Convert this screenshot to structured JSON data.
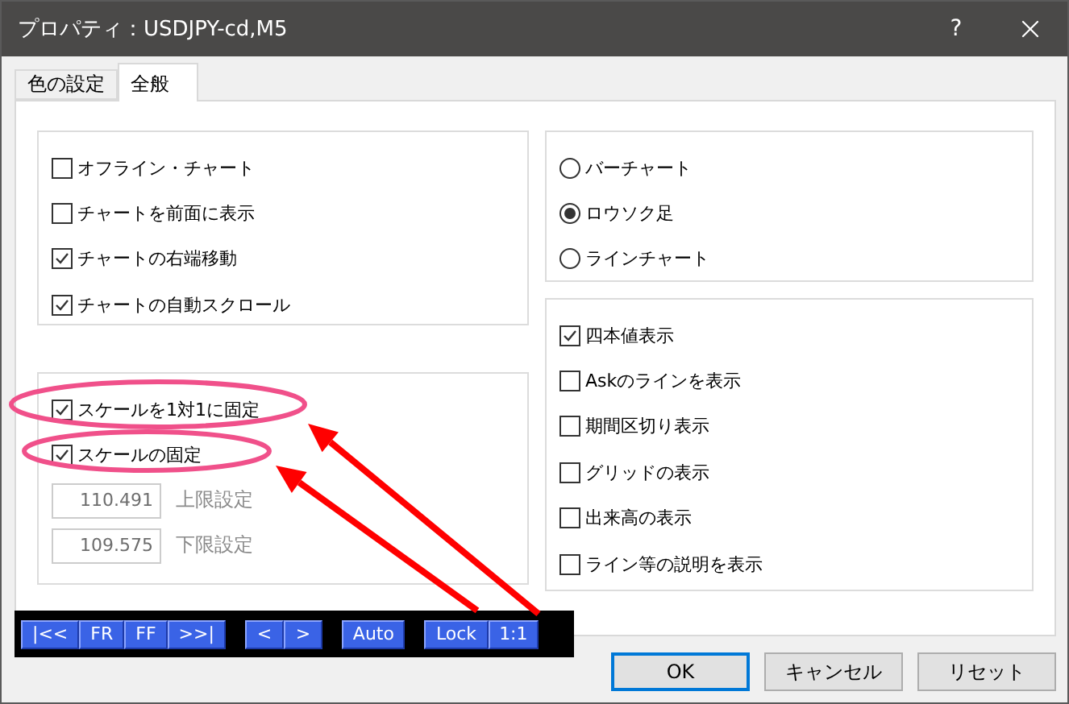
{
  "window": {
    "title": "プロパティ：USDJPY-cd,M5",
    "help": "?"
  },
  "tabs": [
    {
      "label": "色の設定",
      "selected": false
    },
    {
      "label": "全般",
      "selected": true
    }
  ],
  "display_options": [
    {
      "label": "オフライン・チャート",
      "checked": false
    },
    {
      "label": "チャートを前面に表示",
      "checked": false
    },
    {
      "label": "チャートの右端移動",
      "checked": true
    },
    {
      "label": "チャートの自動スクロール",
      "checked": true
    }
  ],
  "chart_type": [
    {
      "label": "バーチャート",
      "selected": false
    },
    {
      "label": "ロウソク足",
      "selected": true
    },
    {
      "label": "ラインチャート",
      "selected": false
    }
  ],
  "scale": {
    "options": [
      {
        "label": "スケールを1対1に固定",
        "checked": true
      },
      {
        "label": "スケールの固定",
        "checked": true
      }
    ],
    "fields": [
      {
        "value": "110.491",
        "label": "上限設定",
        "disabled": true
      },
      {
        "value": "109.575",
        "label": "下限設定",
        "disabled": true
      }
    ]
  },
  "show_options": [
    {
      "label": "四本値表示",
      "checked": true
    },
    {
      "label": "Askのラインを表示",
      "checked": false
    },
    {
      "label": "期間区切り表示",
      "checked": false
    },
    {
      "label": "グリッドの表示",
      "checked": false
    },
    {
      "label": "出来高の表示",
      "checked": false
    },
    {
      "label": "ライン等の説明を表示",
      "checked": false
    }
  ],
  "toolbar_groups": [
    [
      "|<<",
      "FR",
      "FF",
      ">>|"
    ],
    [
      "<",
      ">"
    ],
    [
      "Auto"
    ],
    [
      "Lock",
      "1:1"
    ]
  ],
  "buttons": [
    {
      "label": "OK",
      "default": true
    },
    {
      "label": "キャンセル",
      "default": false
    },
    {
      "label": "リセット",
      "default": false
    }
  ]
}
